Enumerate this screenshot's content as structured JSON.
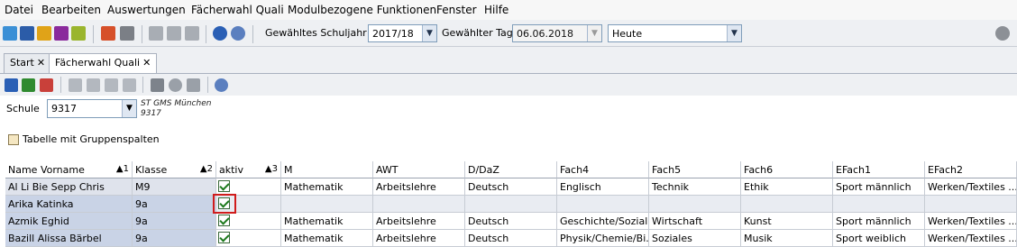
{
  "menu": [
    "Datei",
    "Bearbeiten",
    "Auswertungen",
    "Fächerwahl Quali",
    "Modulbezogene Funktionen",
    "Fenster",
    "Hilfe"
  ],
  "toolbar": {
    "schuljahr_label": "Gewähltes Schuljahr",
    "schuljahr_value": "2017/18",
    "tag_label": "Gewählter Tag",
    "tag_value": "06.06.2018",
    "heute_value": "Heute"
  },
  "tabs": [
    {
      "label": "Start",
      "active": false
    },
    {
      "label": "Fächerwahl Quali",
      "active": true
    }
  ],
  "schule": {
    "label": "Schule",
    "value": "9317",
    "name_line1": "ST GMS München",
    "name_line2": "9317"
  },
  "group_columns_label": "Tabelle mit Gruppenspalten",
  "grid": {
    "columns": [
      {
        "label": "Name Vorname",
        "sort": "1"
      },
      {
        "label": "Klasse",
        "sort": "2"
      },
      {
        "label": "aktiv",
        "sort": "3"
      },
      {
        "label": "M",
        "sort": ""
      },
      {
        "label": "AWT",
        "sort": ""
      },
      {
        "label": "D/DaZ",
        "sort": ""
      },
      {
        "label": "Fach4",
        "sort": ""
      },
      {
        "label": "Fach5",
        "sort": ""
      },
      {
        "label": "Fach6",
        "sort": ""
      },
      {
        "label": "EFach1",
        "sort": ""
      },
      {
        "label": "EFach2",
        "sort": ""
      }
    ],
    "rows": [
      {
        "name": "Al Li Bie Sepp Chris",
        "klasse": "M9",
        "aktiv": true,
        "m": "Mathematik",
        "awt": "Arbeitslehre",
        "d": "Deutsch",
        "f4": "Englisch",
        "f5": "Technik",
        "f6": "Ethik",
        "e1": "Sport männlich",
        "e2": "Werken/Textiles ..."
      },
      {
        "name": "Arika Katinka",
        "klasse": "9a",
        "aktiv": true,
        "m": "",
        "awt": "",
        "d": "",
        "f4": "",
        "f5": "",
        "f6": "",
        "e1": "",
        "e2": ""
      },
      {
        "name": "Azmik Eghid",
        "klasse": "9a",
        "aktiv": true,
        "m": "Mathematik",
        "awt": "Arbeitslehre",
        "d": "Deutsch",
        "f4": "Geschichte/Sozial...",
        "f5": "Wirtschaft",
        "f6": "Kunst",
        "e1": "Sport männlich",
        "e2": "Werken/Textiles ..."
      },
      {
        "name": "Bazill Alissa Bärbel",
        "klasse": "9a",
        "aktiv": true,
        "m": "Mathematik",
        "awt": "Arbeitslehre",
        "d": "Deutsch",
        "f4": "Physik/Chemie/Bi...",
        "f5": "Soziales",
        "f6": "Musik",
        "e1": "Sport weiblich",
        "e2": "Werken/Textiles ..."
      }
    ]
  }
}
